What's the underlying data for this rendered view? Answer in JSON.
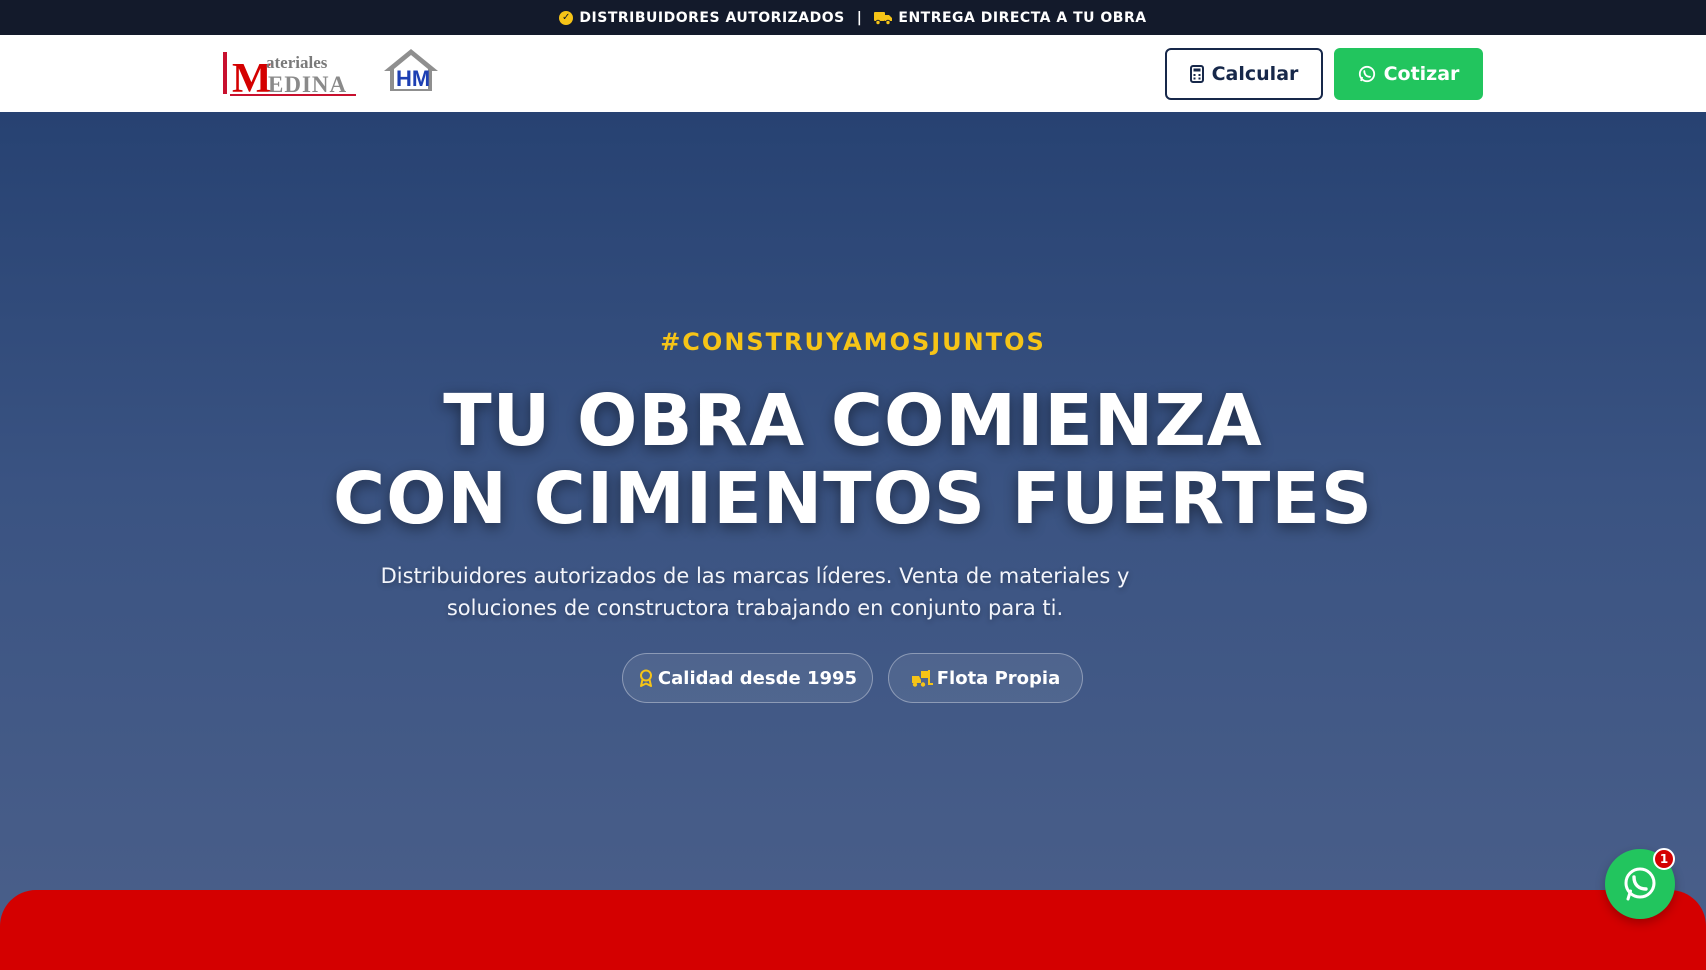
{
  "topbar": {
    "item1": "DISTRIBUIDORES AUTORIZADOS",
    "separator": "|",
    "item2": "ENTREGA DIRECTA A TU OBRA"
  },
  "header": {
    "logo_text_top": "ateriales",
    "logo_text_bottom": "EDINA",
    "logo_letter": "M",
    "house_logo_text": "HM",
    "calc_label": "Calcular",
    "quote_label": "Cotizar"
  },
  "hero": {
    "tagline": "#CONSTRUYAMOSJUNTOS",
    "headline_line1": "TU OBRA COMIENZA",
    "headline_line2": "CON CIMIENTOS FUERTES",
    "subtitle": "Distribuidores autorizados de las marcas líderes. Venta de materiales y soluciones de constructora trabajando en conjunto para ti.",
    "pill_quality": "Calidad desde 1995",
    "pill_fleet": "Flota Propia"
  },
  "whatsapp": {
    "badge_count": "1"
  },
  "colors": {
    "accent_yellow": "#f6c417",
    "navy": "#17284a",
    "whatsapp_green": "#22c55e",
    "brand_red": "#d40000"
  },
  "icons": [
    "check-circle-icon",
    "truck-icon",
    "calculator-icon",
    "whatsapp-icon",
    "award-icon",
    "forklift-icon"
  ]
}
